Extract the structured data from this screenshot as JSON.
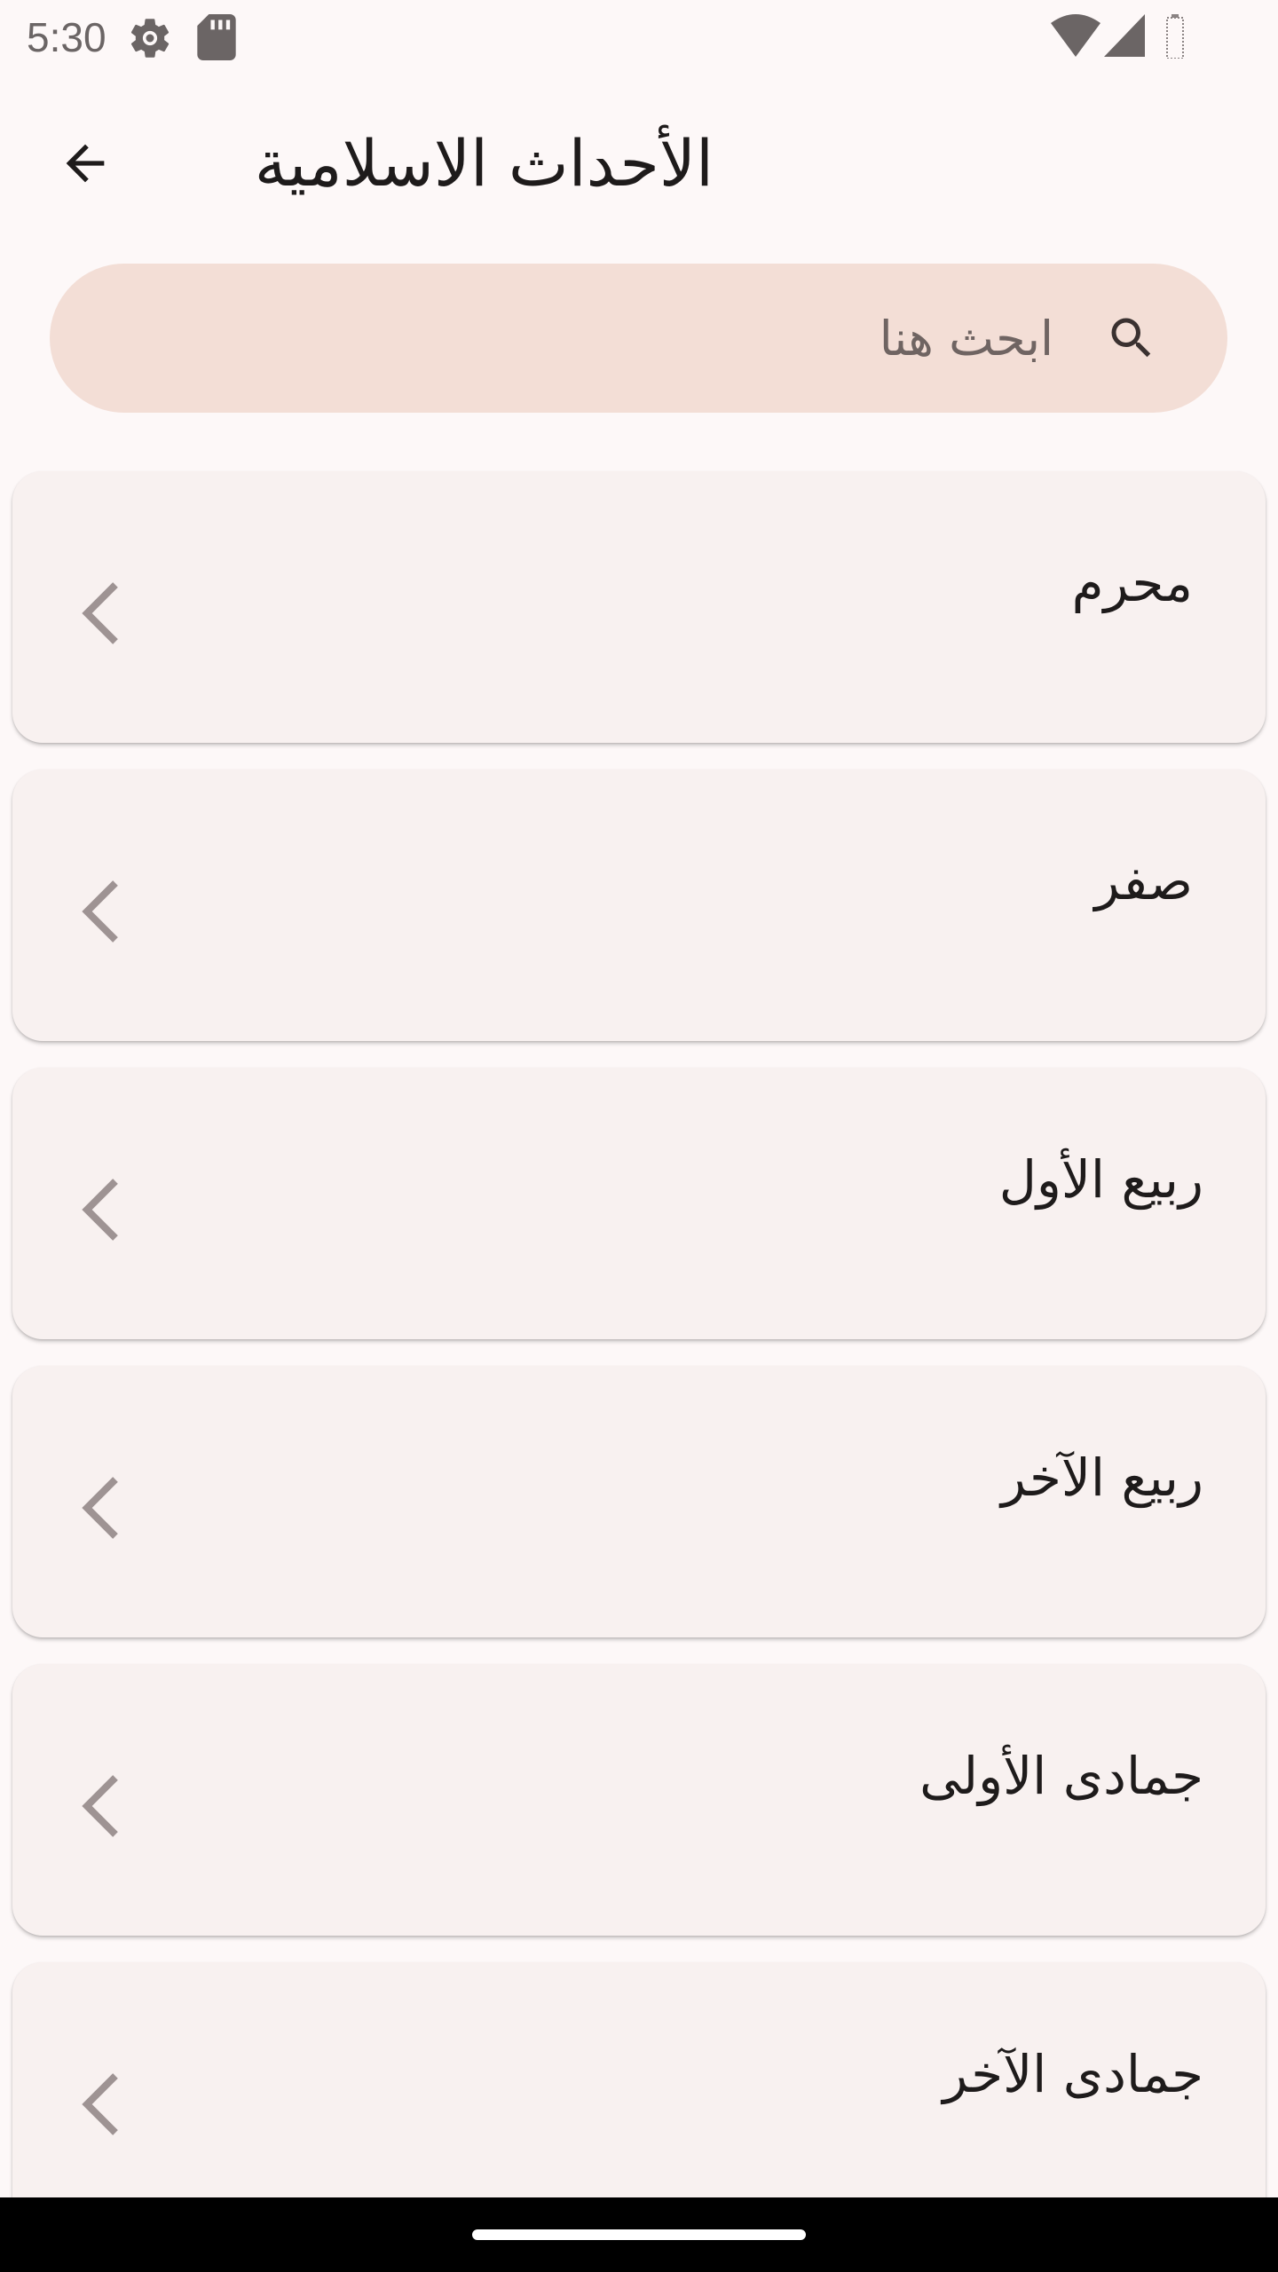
{
  "status_bar": {
    "time": "5:30",
    "icons": [
      "settings-gear-icon",
      "sd-card-icon",
      "wifi-icon",
      "cell-signal-icon",
      "battery-icon"
    ]
  },
  "app_bar": {
    "back_icon": "arrow-back-icon",
    "title": "الأحداث الاسلامية"
  },
  "search": {
    "placeholder": "ابحث هنا",
    "value": "",
    "icon": "search-icon"
  },
  "months": [
    {
      "name": "محرم"
    },
    {
      "name": "صفر"
    },
    {
      "name": "ربيع الأول"
    },
    {
      "name": "ربيع الآخر"
    },
    {
      "name": "جمادى الأولى"
    },
    {
      "name": "جمادى الآخر"
    }
  ],
  "colors": {
    "background": "#fdf8f8",
    "search_background": "#f3ded6",
    "card_background": "#f8f1f0",
    "chevron": "#9e9393",
    "nav_bar": "#000000"
  }
}
